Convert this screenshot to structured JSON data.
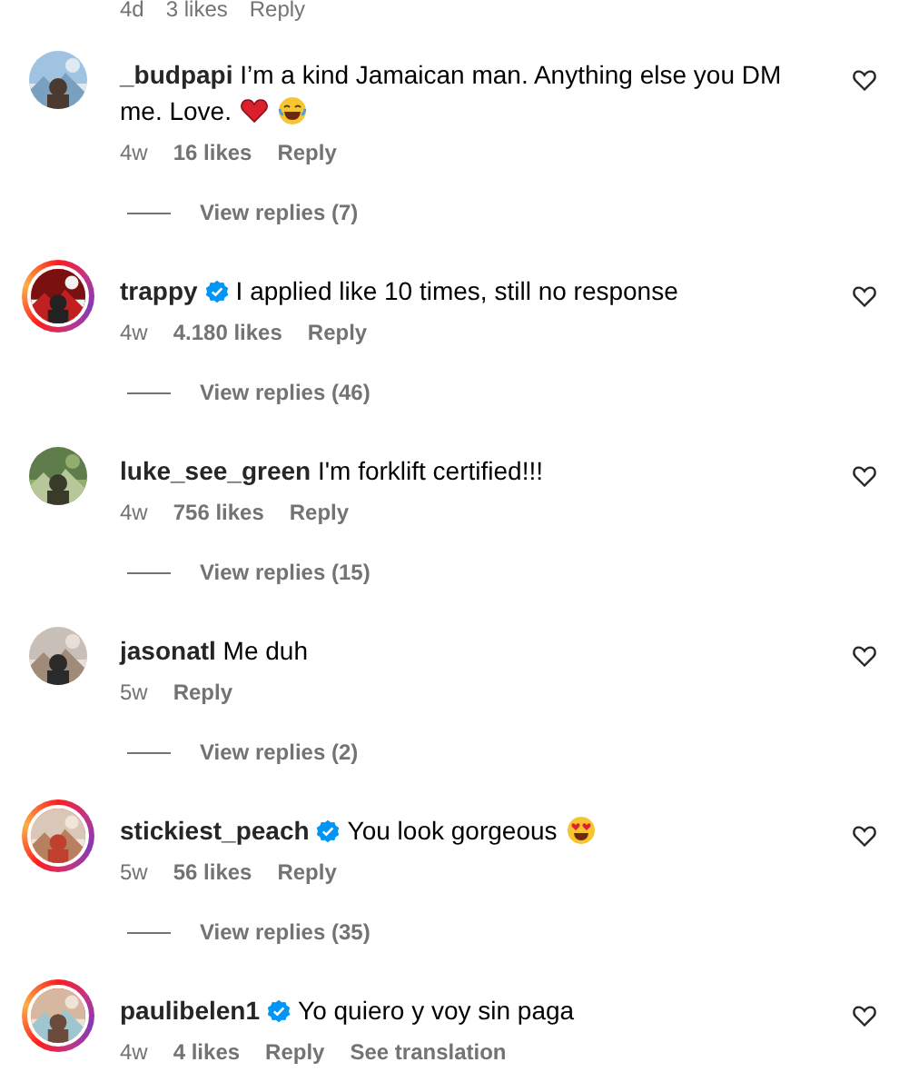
{
  "top_meta": {
    "time": "4d",
    "likes": "3 likes",
    "reply": "Reply"
  },
  "comments": [
    {
      "username": "_budpapi",
      "verified": false,
      "story_ring": false,
      "avatar": {
        "kind": "picture"
      },
      "text": "I’m a kind Jamaican man. Anything else you DM me. Love.",
      "emojis": [
        {
          "kind": "heart"
        },
        {
          "kind": "laughing"
        }
      ],
      "time": "4w",
      "likes": "16 likes",
      "reply": "Reply",
      "liked": false,
      "view_replies": "View replies (7)"
    },
    {
      "username": "trappy",
      "verified": true,
      "story_ring": true,
      "avatar": {
        "kind": "picture"
      },
      "text": "I applied like 10 times, still no response",
      "time": "4w",
      "likes": "4.180 likes",
      "reply": "Reply",
      "liked": false,
      "view_replies": "View replies (46)"
    },
    {
      "username": "luke_see_green",
      "verified": false,
      "story_ring": false,
      "avatar": {
        "kind": "picture"
      },
      "text": "I'm forklift certified!!!",
      "time": "4w",
      "likes": "756 likes",
      "reply": "Reply",
      "liked": false,
      "view_replies": "View replies (15)"
    },
    {
      "username": "jasonatl",
      "verified": false,
      "story_ring": false,
      "avatar": {
        "kind": "picture"
      },
      "text": "Me duh",
      "time": "5w",
      "reply": "Reply",
      "liked": false,
      "view_replies": "View replies (2)"
    },
    {
      "username": "stickiest_peach",
      "verified": true,
      "story_ring": true,
      "avatar": {
        "kind": "picture"
      },
      "text": "You look gorgeous",
      "emojis": [
        {
          "kind": "heart_eyes"
        }
      ],
      "time": "5w",
      "likes": "56 likes",
      "reply": "Reply",
      "liked": false,
      "view_replies": "View replies (35)"
    },
    {
      "username": "paulibelen1",
      "verified": true,
      "story_ring": true,
      "avatar": {
        "kind": "picture"
      },
      "text": "Yo quiero y voy sin paga",
      "time": "4w",
      "likes": "4 likes",
      "reply": "Reply",
      "see_translation": "See translation",
      "liked": false
    }
  ]
}
